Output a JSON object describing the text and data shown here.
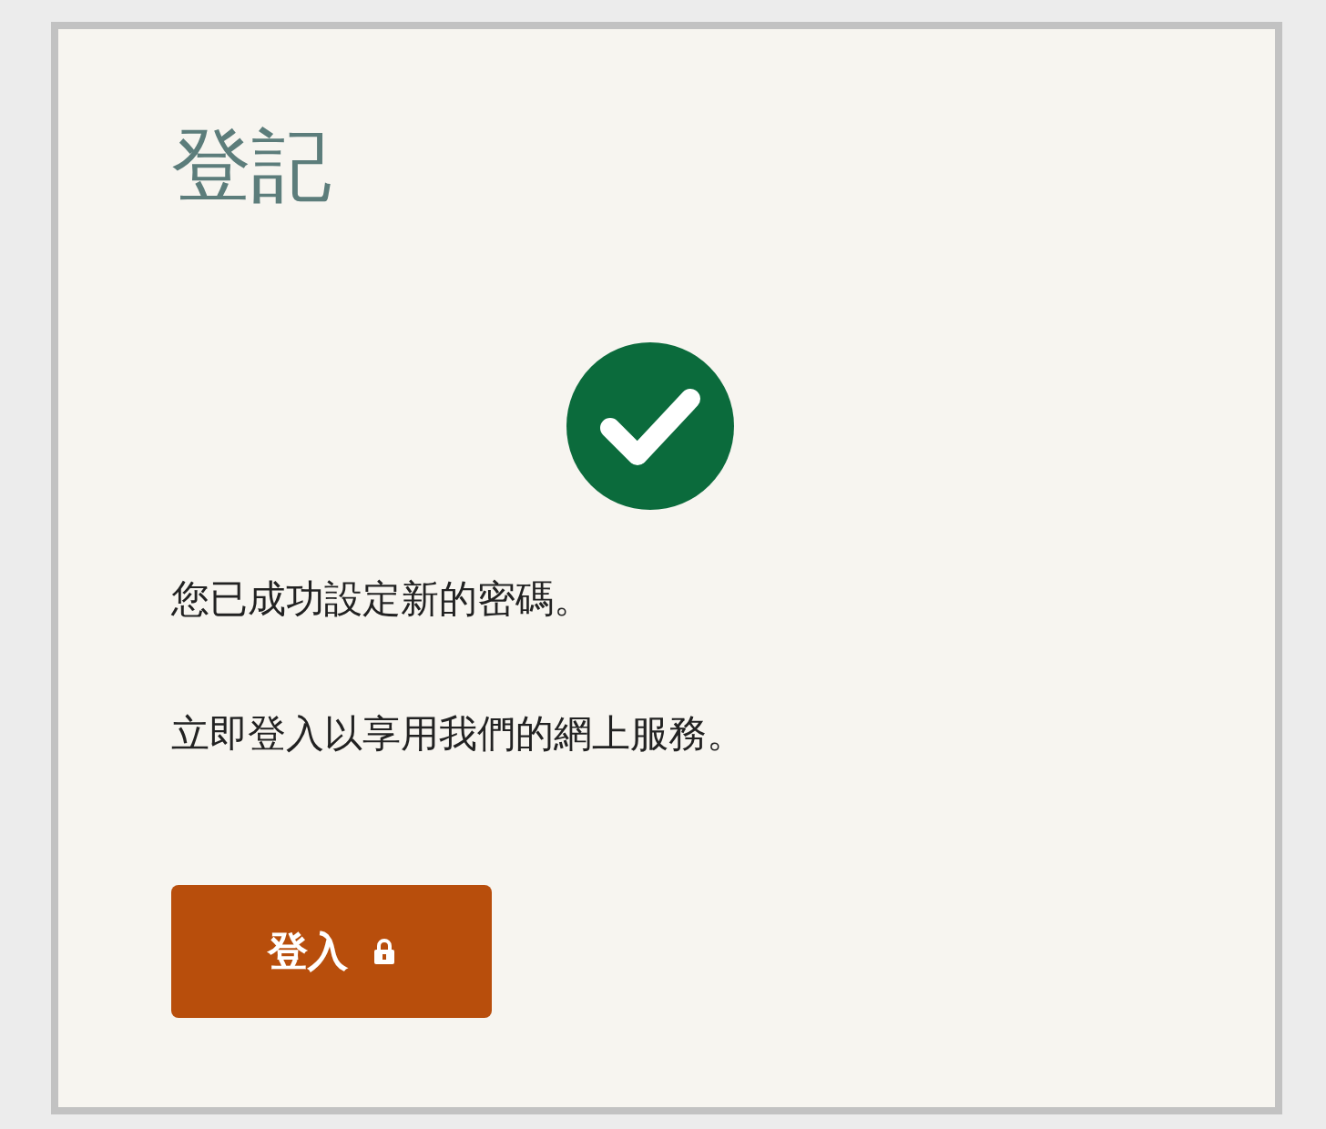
{
  "title": "登記",
  "messages": [
    "您已成功設定新的密碼。",
    "立即登入以享用我們的網上服務。"
  ],
  "button": {
    "label": "登入"
  }
}
